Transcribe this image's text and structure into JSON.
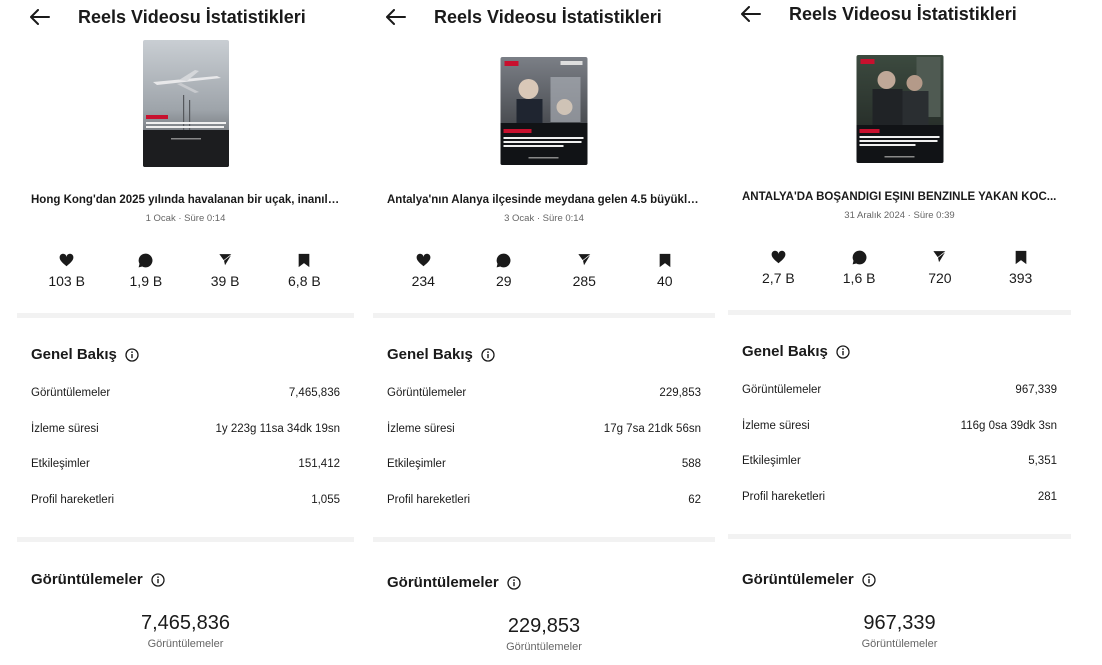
{
  "panels": [
    {
      "title": "Reels Videosu İstatistikleri",
      "thumbnail": {
        "colors": {
          "top": "#c9ced3",
          "bottom": "#4a4d52",
          "banner": "#c8102e"
        }
      },
      "caption": "Hong Kong'dan 2025 yılında havalanan bir uçak, inanılm...",
      "meta": "1 Ocak · Süre 0:14",
      "stats": {
        "likes": "103 B",
        "comments": "1,9 B",
        "shares": "39 B",
        "saves": "6,8 B"
      },
      "overview": {
        "title": "Genel Bakış",
        "rows": [
          {
            "label": "Görüntülemeler",
            "value": "7,465,836"
          },
          {
            "label": "İzleme süresi",
            "value": "1y 223g 11sa 34dk 19sn"
          },
          {
            "label": "Etkileşimler",
            "value": "151,412"
          },
          {
            "label": "Profil hareketleri",
            "value": "1,055"
          }
        ]
      },
      "views": {
        "title": "Görüntülemeler",
        "value": "7,465,836",
        "label": "Görüntülemeler"
      }
    },
    {
      "title": "Reels Videosu İstatistikleri",
      "thumbnail": {
        "colors": {
          "top": "#7b7f86",
          "bottom": "#2b2d31",
          "banner": "#c8102e"
        }
      },
      "caption": "Antalya'nın Alanya ilçesinde meydana gelen 4.5 büyüklü...",
      "meta": "3 Ocak · Süre 0:14",
      "stats": {
        "likes": "234",
        "comments": "29",
        "shares": "285",
        "saves": "40"
      },
      "overview": {
        "title": "Genel Bakış",
        "rows": [
          {
            "label": "Görüntülemeler",
            "value": "229,853"
          },
          {
            "label": "İzleme süresi",
            "value": "17g 7sa 21dk 56sn"
          },
          {
            "label": "Etkileşimler",
            "value": "588"
          },
          {
            "label": "Profil hareketleri",
            "value": "62"
          }
        ]
      },
      "views": {
        "title": "Görüntülemeler",
        "value": "229,853",
        "label": "Görüntülemeler"
      }
    },
    {
      "title": "Reels Videosu İstatistikleri",
      "thumbnail": {
        "colors": {
          "top": "#3c4a3f",
          "bottom": "#1e2220",
          "banner": "#c8102e"
        }
      },
      "caption": "ANTALYA'DA BOŞANDIĞI EŞİNİ BENZİNLE YAKAN KOC...",
      "meta": "31 Aralık 2024 · Süre 0:39",
      "stats": {
        "likes": "2,7 B",
        "comments": "1,6 B",
        "shares": "720",
        "saves": "393"
      },
      "overview": {
        "title": "Genel Bakış",
        "rows": [
          {
            "label": "Görüntülemeler",
            "value": "967,339"
          },
          {
            "label": "İzleme süresi",
            "value": "116g 0sa 39dk 3sn"
          },
          {
            "label": "Etkileşimler",
            "value": "5,351"
          },
          {
            "label": "Profil hareketleri",
            "value": "281"
          }
        ]
      },
      "views": {
        "title": "Görüntülemeler",
        "value": "967,339",
        "label": "Görüntülemeler"
      }
    }
  ],
  "icons": {
    "back": "arrow-left-icon",
    "likes": "heart-icon",
    "comments": "comment-bubble-icon",
    "shares": "paper-plane-icon",
    "saves": "bookmark-icon",
    "info": "info-circle-icon"
  },
  "colors": {
    "text": "#1a1a1a",
    "secondary": "#666666",
    "divider": "#f2f2f2"
  }
}
